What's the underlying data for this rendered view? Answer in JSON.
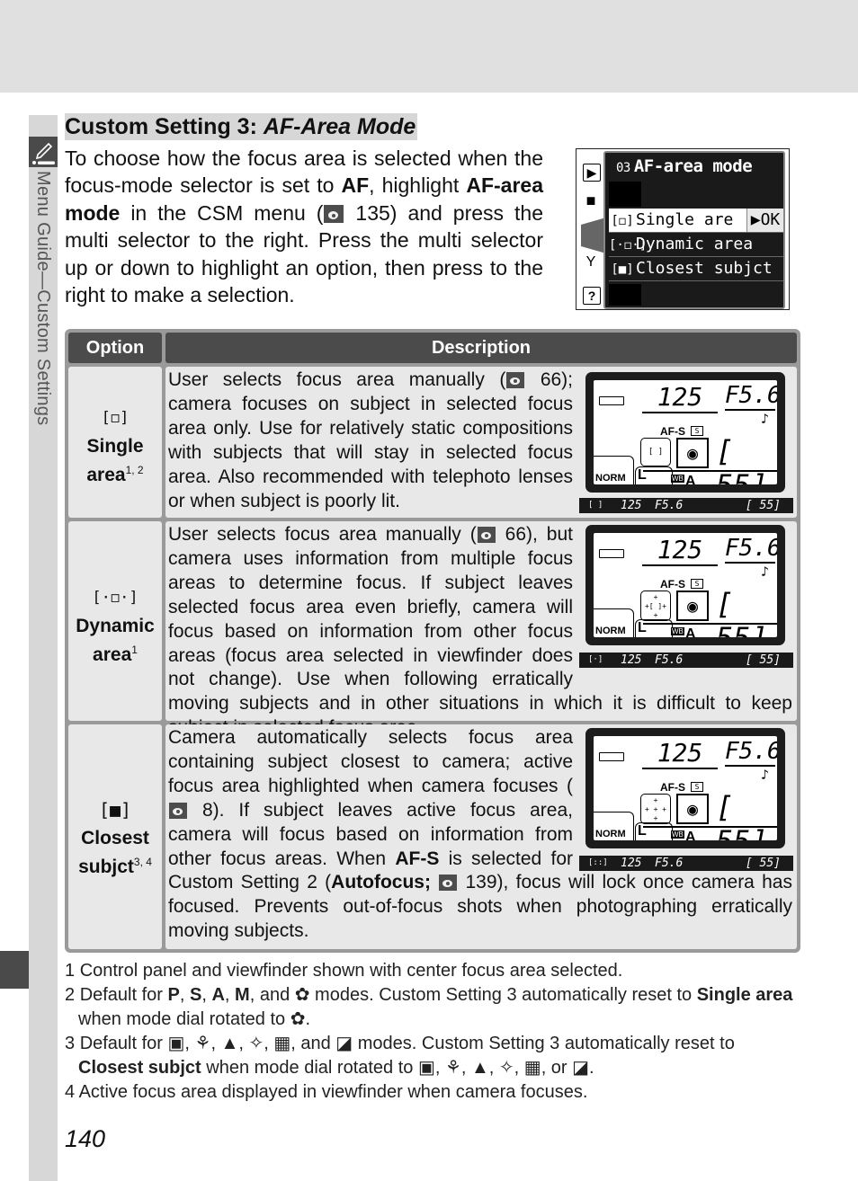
{
  "page": {
    "title_plain": "Custom Setting 3: ",
    "title_italic": "AF-Area Mode",
    "section_label": "Menu Guide—Custom Settings",
    "section_icon": "pencil-icon",
    "page_number": "140",
    "colors": {
      "dark": "#4b4b4b",
      "table_bg": "#9a9a9a",
      "cell_bg": "#e8e8e8",
      "sidebar": "#d7d7d7"
    }
  },
  "intro": {
    "t1": "To choose how the focus area is selected when the focus-mode selector is set to ",
    "b1": "AF",
    "t2": ", highlight ",
    "b2": "AF-area mode",
    "t3": " in the CSM menu (",
    "ref": "135",
    "t4": ") and press the multi selector to the right.  Press the multi selector up or down to highlight an option, then press to the right to make a selection."
  },
  "menu_screen": {
    "number": "03",
    "title": "AF-area mode",
    "side_icons": [
      "playback-icon",
      "camera-icon",
      "pencil-icon",
      "wrench-icon",
      "help-icon"
    ],
    "items": [
      {
        "icon": "[◻]",
        "label": "Single are",
        "selected": true,
        "action": "▶OK"
      },
      {
        "icon": "[·◻·]",
        "label": "Dynamic area",
        "selected": false
      },
      {
        "icon": "[■]",
        "label": "Closest subjct",
        "selected": false
      }
    ]
  },
  "table": {
    "headers": [
      "Option",
      "Description"
    ],
    "rows": [
      {
        "glyph": "[◻]",
        "name1": "Single",
        "name2": "area",
        "sup": "1, 2",
        "d1": "User selects focus area manually (",
        "ref1": "66",
        "d2": "); camera focuses on subject in selected focus area only.  Use for relatively static compositions with subjects that will stay in selected focus area.  Also recommended with telephoto lenses or when subject is poorly lit.",
        "lcd": {
          "shutter": "125",
          "aperture": "F5.6",
          "af": "AF-S",
          "frames": "[ 55]",
          "quality": "NORM",
          "size": "L",
          "wb": "A"
        },
        "vf": {
          "shutter": "125",
          "aperture": "F5.6",
          "frames": "[ 55]"
        }
      },
      {
        "glyph": "[·◻·]",
        "name1": "Dynamic",
        "name2": "area",
        "sup": "1",
        "d1": "User selects focus area manually (",
        "ref1": "66",
        "d2": "), but camera uses information from multiple focus areas to determine focus.  If subject leaves selected focus area even briefly, camera will focus based on information from other focus areas (focus area selected in viewfinder does not change).  Use when following erratically moving subjects and in other situations in which it is difficult to keep subject in selected focus area.",
        "lcd": {
          "shutter": "125",
          "aperture": "F5.6",
          "af": "AF-S",
          "frames": "[ 55]",
          "quality": "NORM",
          "size": "L",
          "wb": "A"
        },
        "vf": {
          "shutter": "125",
          "aperture": "F5.6",
          "frames": "[ 55]"
        }
      },
      {
        "glyph": "[■]",
        "name1": "Closest",
        "name2": "subjct",
        "sup": "3, 4",
        "d1": "Camera automatically selects focus area containing subject closest to camera; active focus area highlighted when camera focuses (",
        "ref1": "8",
        "d2": ").  If subject leaves active focus area, camera will focus based on information from other focus areas.  When ",
        "b1": "AF-S",
        "d3": " is selected for Custom Setting 2 (",
        "b2": "Autofocus;",
        "ref2": "139",
        "d4": "), focus will lock once camera has focused.  Prevents out-of-focus shots when photographing erratically moving subjects.",
        "lcd": {
          "shutter": "125",
          "aperture": "F5.6",
          "af": "AF-S",
          "frames": "[ 55]",
          "quality": "NORM",
          "size": "L",
          "wb": "A"
        },
        "vf": {
          "shutter": "125",
          "aperture": "F5.6",
          "frames": "[ 55]"
        }
      }
    ]
  },
  "footnotes": [
    {
      "n": "1",
      "text": "Control panel and viewfinder shown with center focus area selected."
    },
    {
      "n": "2",
      "a": "Default for ",
      "b": "P",
      "c": ", ",
      "d": "S",
      "e": ", ",
      "f": "A",
      "g": ", ",
      "h": "M",
      "i": ", and ✿ modes.  Custom Setting 3 automatically reset to ",
      "j": "Single area",
      "k": " when mode dial rotated to ✿."
    },
    {
      "n": "3",
      "a": "Default for ▣, ⚘, ▲, ✧, ▦, and ◪ modes.  Custom Setting 3 automatically reset to ",
      "b": "Closest subjct",
      "c": " when mode dial rotated to ▣, ⚘, ▲, ✧, ▦, or ◪."
    },
    {
      "n": "4",
      "text": "Active focus area displayed in viewfinder when camera focuses."
    }
  ]
}
